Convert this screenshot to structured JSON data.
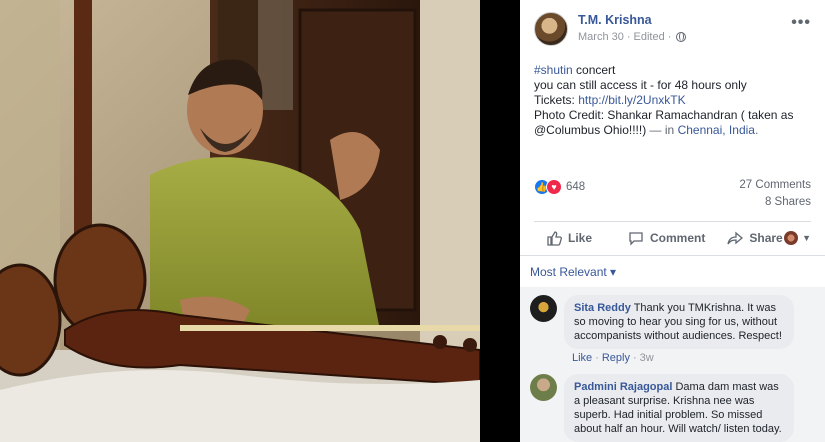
{
  "post": {
    "author": "T.M. Krishna",
    "date": "March 30",
    "edited": "Edited",
    "text": {
      "hashtag": "#shutin",
      "line1_rest": " concert",
      "line2": "you can still access it - for 48 hours only",
      "tickets_label": "Tickets: ",
      "tickets_link": "http://bit.ly/2UnxkTK",
      "credit": "Photo Credit: Shankar Ramachandran ( taken as @Columbus Ohio!!!!)",
      "location_prefix": " — in ",
      "location": "Chennai, India",
      "location_suffix": "."
    }
  },
  "stats": {
    "reactions_count": "648",
    "comments": "27 Comments",
    "shares": "8 Shares"
  },
  "actions": {
    "like": "Like",
    "comment": "Comment",
    "share": "Share"
  },
  "comments_header": "Most Relevant ▾",
  "comments": [
    {
      "name": "Sita Reddy",
      "text": " Thank you TMKrishna. It was so moving to hear you sing for us, without accompanists without audiences. Respect!",
      "like": "Like",
      "reply": "Reply",
      "time": "3w"
    },
    {
      "name": "Padmini Rajagopal",
      "text": " Dama dam mast was a pleasant surprise. Krishna nee was superb. Had initial problem. So missed about half an hour. Will watch/ listen today."
    }
  ],
  "colors": {
    "link": "#385898",
    "like_blue": "#1877f2",
    "love_red": "#f0284a",
    "kurta": "#9aa03a"
  },
  "icons": [
    "more-icon",
    "globe-icon",
    "like-icon",
    "comment-icon",
    "share-icon",
    "chevron-down-icon"
  ]
}
